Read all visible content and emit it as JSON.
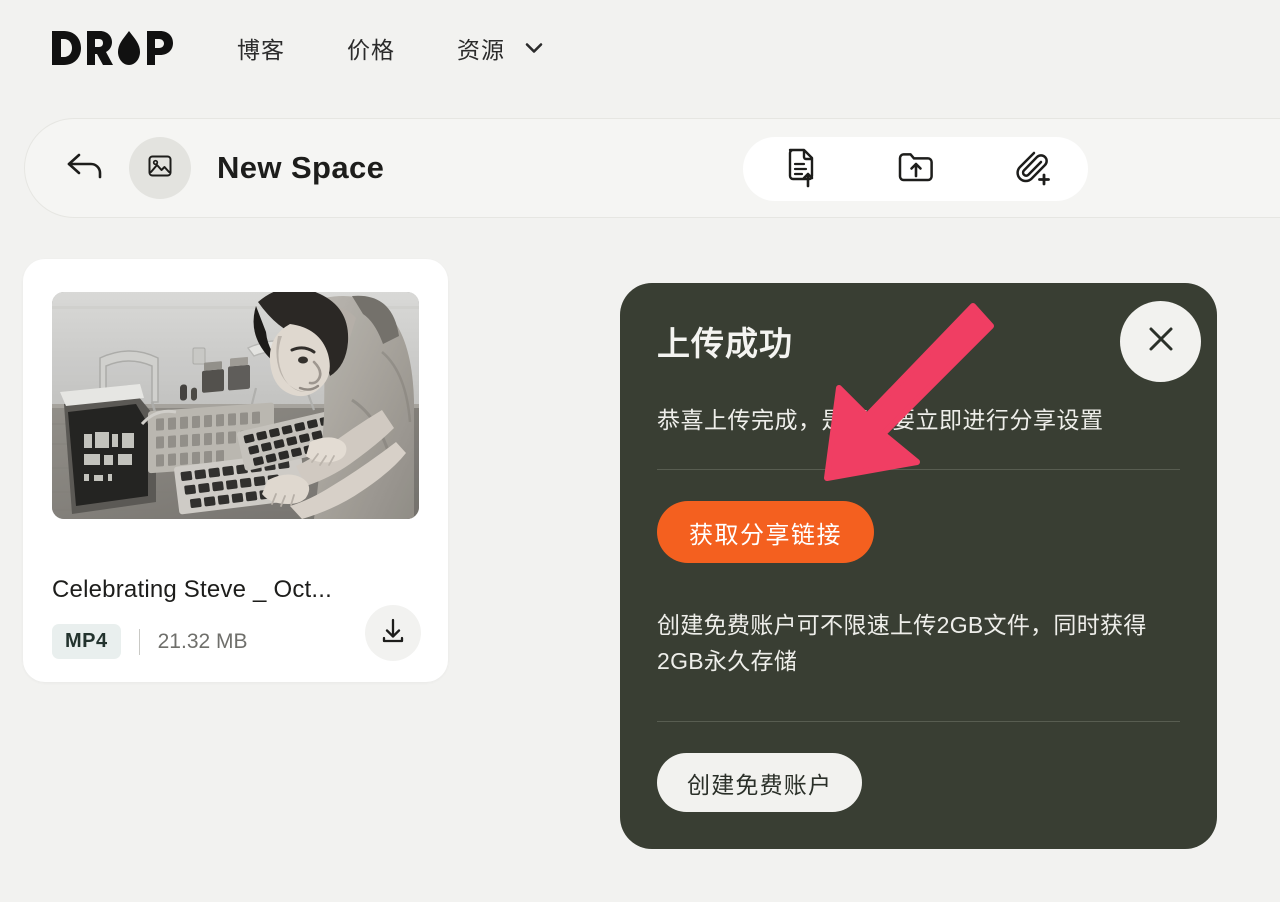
{
  "brand": {
    "logo_text": "DROP",
    "logo_icon": "water-drop-icon"
  },
  "topnav": {
    "links": [
      {
        "label": "博客",
        "icon": null
      },
      {
        "label": "价格",
        "icon": null
      },
      {
        "label": "资源",
        "icon": "chevron-down-icon"
      }
    ]
  },
  "toolbar": {
    "back_icon": "back-arrow-icon",
    "space_icon": "image-placeholder-icon",
    "space_title": "New Space",
    "actions": [
      {
        "name": "upload-file",
        "icon": "file-upload-icon"
      },
      {
        "name": "upload-folder",
        "icon": "folder-upload-icon"
      },
      {
        "name": "add-link",
        "icon": "link-add-icon"
      }
    ]
  },
  "file_card": {
    "thumbnail_alt": "black-and-white photo of a young man typing at an early computer workstation",
    "name": "Celebrating Steve _ Oct...",
    "format": "MP4",
    "separator": "|",
    "size": "21.32 MB",
    "download_icon": "download-icon"
  },
  "dialog": {
    "title": "上传成功",
    "subtitle": "恭喜上传完成，是否需要立即进行分享设置",
    "close_icon": "close-icon",
    "primary_button": "获取分享链接",
    "promo_text": "创建免费账户可不限速上传2GB文件，同时获得2GB永久存储",
    "secondary_button": "创建免费账户"
  },
  "annotation": {
    "arrow_icon": "pointer-arrow-icon",
    "arrow_color": "#f03e63",
    "arrow_direction": "down-left"
  },
  "colors": {
    "page_bg": "#f2f2f0",
    "dialog_bg": "#393e33",
    "accent_orange": "#f4601f",
    "badge_bg": "#e9efee",
    "card_bg": "#ffffff",
    "annotation_pink": "#f03e63"
  }
}
